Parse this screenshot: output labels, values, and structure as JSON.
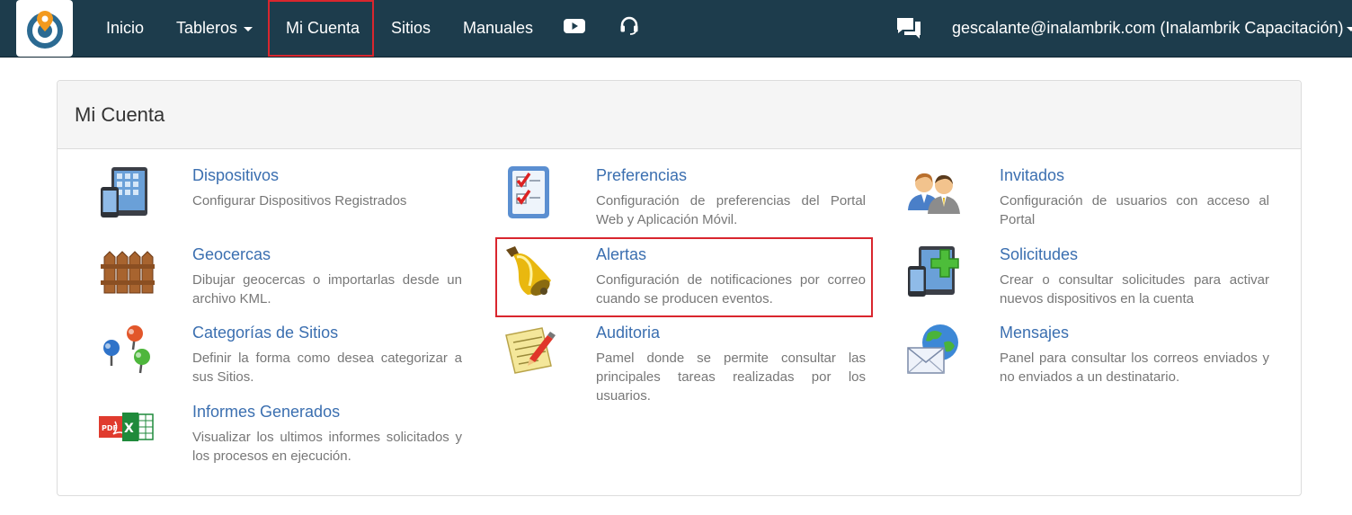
{
  "nav": {
    "inicio": "Inicio",
    "tableros": "Tableros",
    "mi_cuenta": "Mi Cuenta",
    "sitios": "Sitios",
    "manuales": "Manuales",
    "user": "gescalante@inalambrik.com (Inalambrik Capacitación)"
  },
  "panel": {
    "title": "Mi Cuenta",
    "items": [
      {
        "title": "Dispositivos",
        "desc": "Configurar Dispositivos Registrados",
        "icon": "devices-icon"
      },
      {
        "title": "Preferencias",
        "desc": "Configuración de preferencias del Portal Web y Aplicación Móvil.",
        "icon": "checklist-icon"
      },
      {
        "title": "Invitados",
        "desc": "Configuración de usuarios con acceso al Portal",
        "icon": "users-icon"
      },
      {
        "title": "Geocercas",
        "desc": "Dibujar geocercas o importarlas desde un archivo KML.",
        "icon": "fence-icon"
      },
      {
        "title": "Alertas",
        "desc": "Configuración de notificaciones por correo cuando se producen eventos.",
        "icon": "bell-icon"
      },
      {
        "title": "Solicitudes",
        "desc": "Crear o consultar solicitudes para activar nuevos dispositivos en la cuenta",
        "icon": "add-device-icon"
      },
      {
        "title": "Categorías de Sitios",
        "desc": "Definir la forma como desea categorizar a sus Sitios.",
        "icon": "pins-icon"
      },
      {
        "title": "Auditoria",
        "desc": "Pamel donde se permite consultar las principales tareas realizadas por los usuarios.",
        "icon": "notepad-pencil-icon"
      },
      {
        "title": "Mensajes",
        "desc": "Panel para consultar los correos enviados y no enviados a un destinatario.",
        "icon": "mail-globe-icon"
      },
      {
        "title": "Informes Generados",
        "desc": "Visualizar los ultimos informes solicitados y los procesos en ejecución.",
        "icon": "pdf-excel-icon"
      }
    ]
  },
  "colors": {
    "navbar": "#1d3c4c",
    "link": "#3b6fb0",
    "highlight": "#d9262e"
  }
}
